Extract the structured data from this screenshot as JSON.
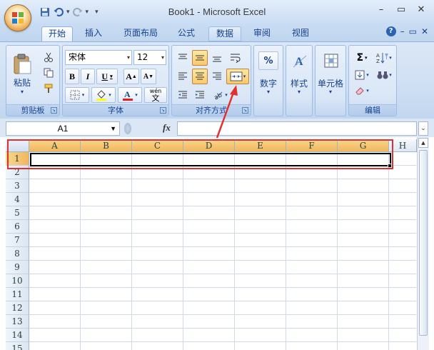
{
  "window": {
    "title": "Book1 - Microsoft Excel",
    "controls": {
      "minimize": "–",
      "restore": "▭",
      "close": "✕"
    }
  },
  "quick_access": {
    "save": "save-icon",
    "undo": "undo-icon",
    "redo": "redo-icon",
    "customize": "▾"
  },
  "tabs": [
    {
      "label": "开始",
      "active": true
    },
    {
      "label": "插入"
    },
    {
      "label": "页面布局"
    },
    {
      "label": "公式"
    },
    {
      "label": "数据",
      "highlighted": true
    },
    {
      "label": "审阅"
    },
    {
      "label": "视图"
    }
  ],
  "ribbon_right": {
    "help": "?",
    "minimize": "–",
    "restore": "▭",
    "close": "✕"
  },
  "groups": {
    "clipboard": {
      "label": "剪贴板",
      "paste": "粘贴"
    },
    "font": {
      "label": "字体",
      "font_name": "宋体",
      "font_size": "12",
      "bold": "B",
      "italic": "I",
      "underline": "U",
      "grow": "A",
      "shrink": "A",
      "phonetic": "wén"
    },
    "alignment": {
      "label": "对齐方式"
    },
    "number": {
      "label": "数字",
      "percent": "%"
    },
    "styles": {
      "label": "样式"
    },
    "cells": {
      "label": "单元格"
    },
    "editing": {
      "label": "编辑",
      "sum": "Σ"
    }
  },
  "formula_bar": {
    "name_box": "A1",
    "fx": "fx",
    "value": ""
  },
  "sheet": {
    "columns": [
      "A",
      "B",
      "C",
      "D",
      "E",
      "F",
      "G",
      "H"
    ],
    "selected_columns": [
      "A",
      "B",
      "C",
      "D",
      "E",
      "F",
      "G"
    ],
    "rows": [
      "1",
      "2",
      "3",
      "4",
      "5",
      "6",
      "7",
      "8",
      "9",
      "10",
      "11",
      "12",
      "13",
      "14",
      "15"
    ],
    "selected_rows": [
      "1"
    ],
    "selection": "A1:G1"
  },
  "colors": {
    "accent_red": "#e03030",
    "selected_header": "#f1b65d",
    "ribbon_bg": "#cfdff3"
  }
}
